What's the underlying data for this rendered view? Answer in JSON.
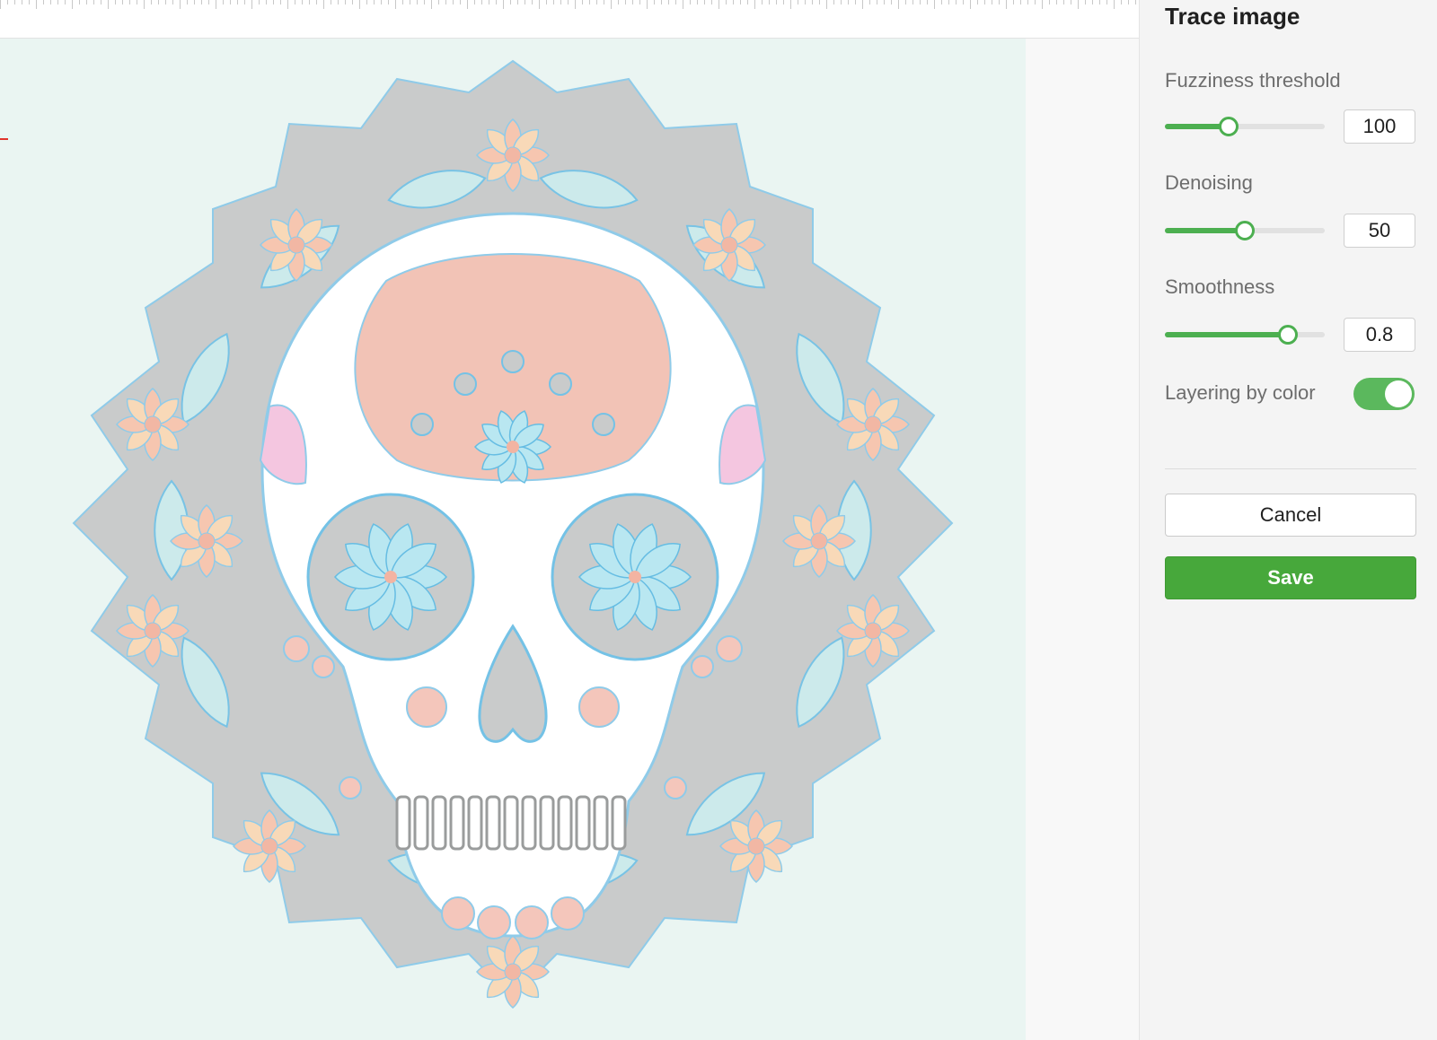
{
  "panel": {
    "title": "Trace image",
    "fields": [
      {
        "label": "Fuzziness threshold",
        "value": "100",
        "level": 0.4
      },
      {
        "label": "Denoising",
        "value": "50",
        "level": 0.5
      },
      {
        "label": "Smoothness",
        "value": "0.8",
        "level": 0.77
      }
    ],
    "layering": {
      "label": "Layering by color",
      "enabled": true
    },
    "cancel_label": "Cancel",
    "save_label": "Save"
  },
  "colors": {
    "accent": "#4caf50",
    "save_button": "#47a83b",
    "canvas_background": "#eaf5f2",
    "trace_outline": "#72c2e8",
    "origin_marker": "#e0342c"
  },
  "canvas": {
    "image": "traced sugar skull artwork (calavera with flowers and leaves)"
  }
}
